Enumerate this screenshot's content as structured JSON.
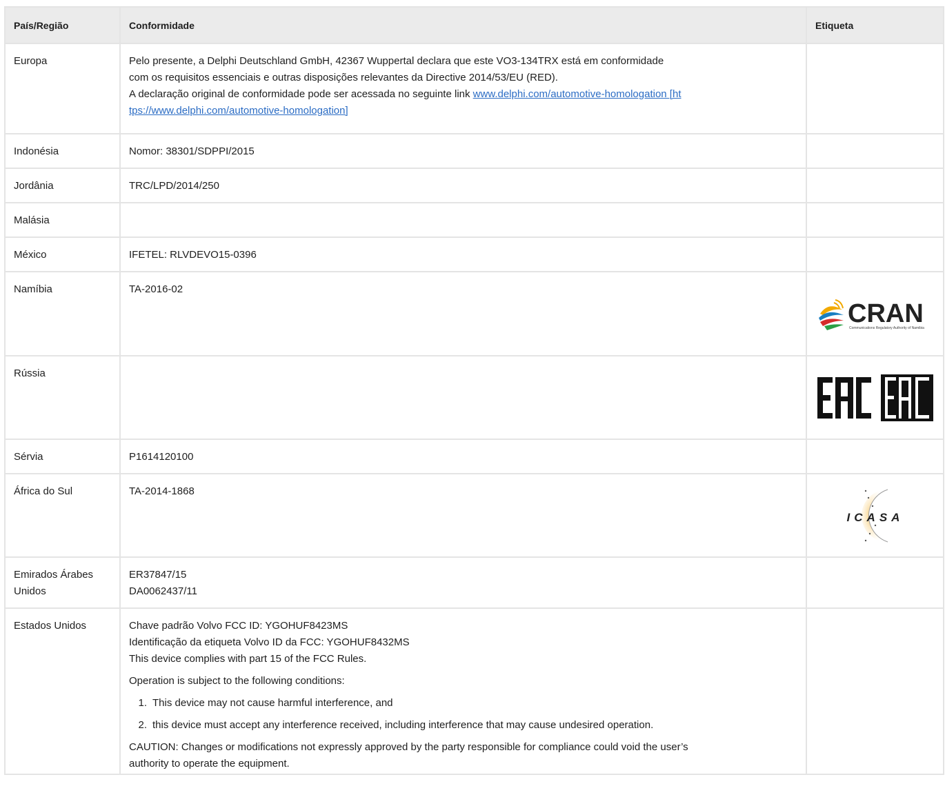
{
  "headers": {
    "country": "País/Região",
    "conformity": "Conformidade",
    "label": "Etiqueta"
  },
  "rows": {
    "europe": {
      "country": "Europa",
      "line1": "Pelo presente, a Delphi Deutschland GmbH, 42367 Wuppertal declara que este VO3-134TRX está em conformidade",
      "line2": "com os requisitos essenciais e outras disposições relevantes da Directive 2014/53/EU (RED).",
      "line3_text": "A declaração original de conformidade pode ser acessada no seguinte link ",
      "link_part1": "www.delphi.com/automotive-homologation [ht",
      "link_part2": "tps://www.delphi.com/automotive-homologation]"
    },
    "indonesia": {
      "country": "Indonésia",
      "value": "Nomor: 38301/SDPPI/2015"
    },
    "jordan": {
      "country": "Jordânia",
      "value": "TRC/LPD/2014/250"
    },
    "malaysia": {
      "country": "Malásia",
      "value": ""
    },
    "mexico": {
      "country": "México",
      "value": "IFETEL: RLVDEVO15-0396"
    },
    "namibia": {
      "country": "Namíbia",
      "value": "TA-2016-02",
      "logo_text": "CRAN",
      "logo_subtext": "Communications Regulatory Authority of Namibia"
    },
    "russia": {
      "country": "Rússia",
      "value": "",
      "logo_text": "EAC"
    },
    "serbia": {
      "country": "Sérvia",
      "value": "P1614120100"
    },
    "south_africa": {
      "country": "África do Sul",
      "value": "TA-2014-1868",
      "logo_text": "ICASA"
    },
    "uae": {
      "country_line1": "Emirados Árabes",
      "country_line2": "Unidos",
      "value_line1": "ER37847/15",
      "value_line2": "DA0062437/11"
    },
    "usa": {
      "country": "Estados Unidos",
      "line1": "Chave padrão Volvo FCC ID: YGOHUF8423MS",
      "line2": "Identificação da etiqueta Volvo ID da FCC: YGOHUF8432MS",
      "line3": "This device complies with part 15 of the FCC Rules.",
      "conditions_intro": "Operation is subject to the following conditions:",
      "item1_num": "1.",
      "item1": "This device may not cause harmful interference, and",
      "item2_num": "2.",
      "item2": "this device must accept any interference received, including interference that may cause undesired operation.",
      "caution_line1": "CAUTION: Changes or modifications not expressly approved by the party responsible for compliance could void the user’s",
      "caution_line2": "authority to operate the equipment."
    }
  },
  "colors": {
    "header_bg": "#ebebeb",
    "border": "#e4e4e4",
    "link": "#2b6cc4",
    "cran_dark": "#222222",
    "eac_dark": "#111111"
  }
}
